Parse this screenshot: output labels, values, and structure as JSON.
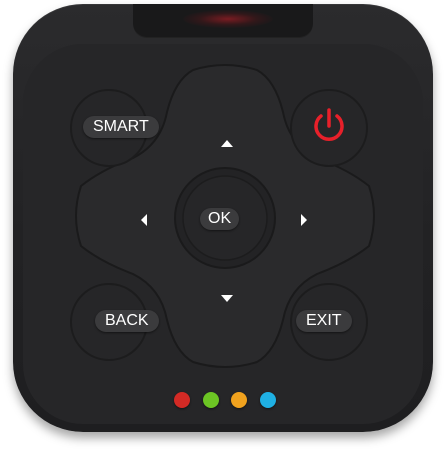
{
  "buttons": {
    "smart": "SMART",
    "ok": "OK",
    "back": "BACK",
    "exit": "EXIT"
  },
  "icons": {
    "power": "power-icon",
    "up": "arrow-up-icon",
    "down": "arrow-down-icon",
    "left": "arrow-left-icon",
    "right": "arrow-right-icon"
  },
  "colors": {
    "body": "#222224",
    "button": "#3b3b3d",
    "power": "#e8202a",
    "red": "#d32a25",
    "green": "#6cc524",
    "yellow": "#f0a21e",
    "blue": "#1fb0e3"
  },
  "color_buttons": [
    "red",
    "green",
    "yellow",
    "blue"
  ]
}
